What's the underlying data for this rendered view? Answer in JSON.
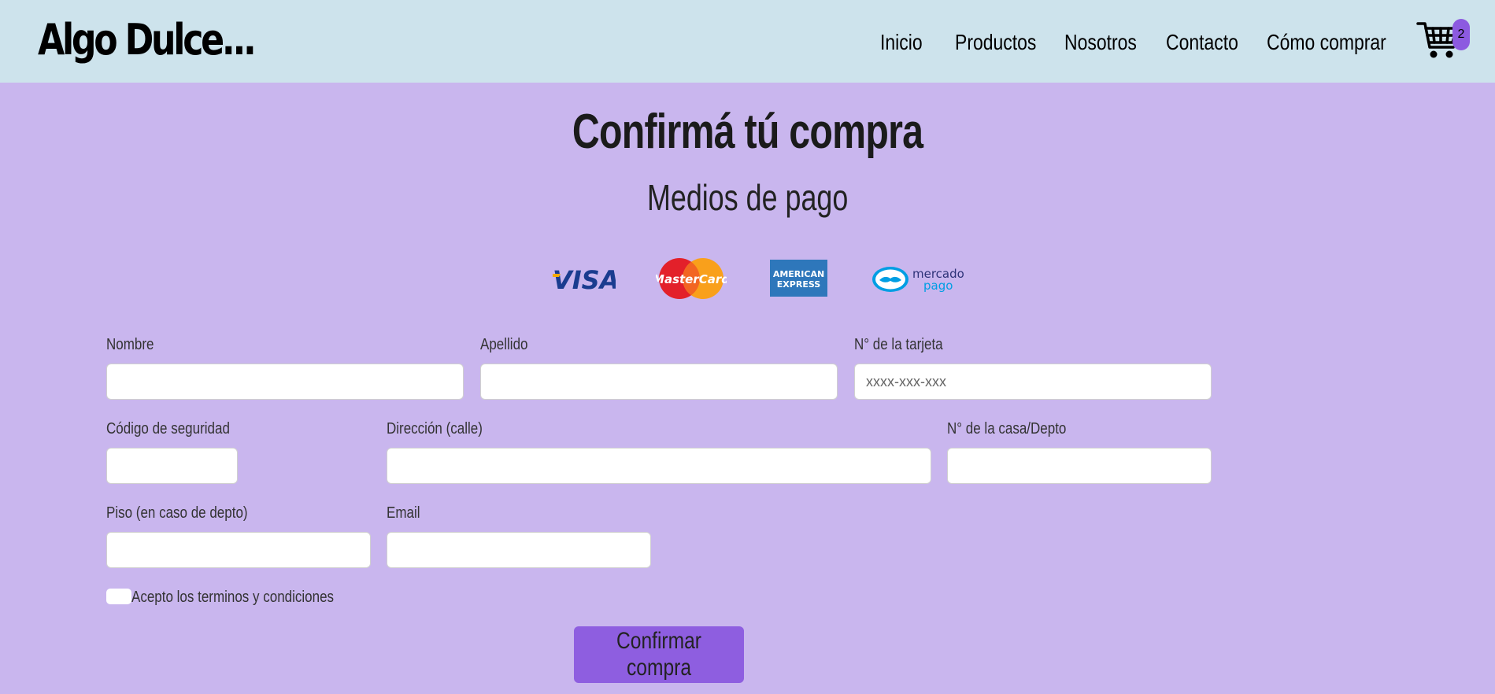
{
  "brand": {
    "logo": "Algo Dulce..."
  },
  "nav": {
    "items": [
      {
        "label": "Inicio"
      },
      {
        "label": "Productos"
      },
      {
        "label": "Nosotros"
      },
      {
        "label": "Contacto"
      },
      {
        "label": "Cómo comprar"
      }
    ],
    "cart": {
      "icon": "cart-icon",
      "count": "2"
    }
  },
  "page": {
    "title": "Confirmá tú compra",
    "subtitle": "Medios de pago"
  },
  "payment_methods": [
    {
      "name": "VISA",
      "icon": "visa-logo"
    },
    {
      "name": "MasterCard",
      "icon": "mastercard-logo"
    },
    {
      "name": "AMERICAN EXPRESS",
      "icon": "amex-logo"
    },
    {
      "name": "mercado pago",
      "icon": "mercadopago-logo"
    }
  ],
  "form": {
    "nombre": {
      "label": "Nombre",
      "value": "",
      "placeholder": ""
    },
    "apellido": {
      "label": "Apellido",
      "value": "",
      "placeholder": ""
    },
    "tarjeta": {
      "label": "N° de la tarjeta",
      "value": "",
      "placeholder": "xxxx-xxx-xxx"
    },
    "codigo": {
      "label": "Código de seguridad",
      "value": "",
      "placeholder": ""
    },
    "direccion": {
      "label": "Dirección (calle)",
      "value": "",
      "placeholder": ""
    },
    "casa": {
      "label": "N° de la casa/Depto",
      "value": "",
      "placeholder": ""
    },
    "piso": {
      "label": "Piso (en caso de depto)",
      "value": "",
      "placeholder": ""
    },
    "email": {
      "label": "Email",
      "value": "",
      "placeholder": ""
    },
    "terms": {
      "label": "Acepto los terminos y condiciones",
      "checked": false
    },
    "submit_label": "Confirmar compra"
  },
  "colors": {
    "header_bg": "#cde3ec",
    "page_bg": "#c9b6ee",
    "accent": "#8e5ee0"
  }
}
